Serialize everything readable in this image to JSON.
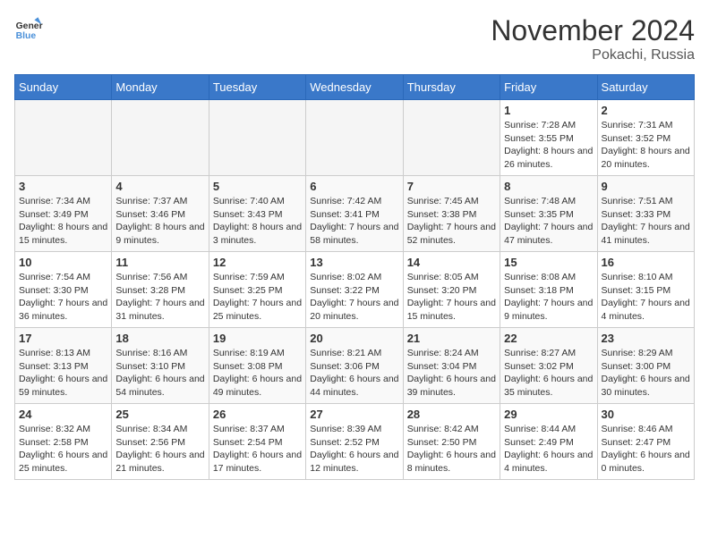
{
  "header": {
    "logo_general": "General",
    "logo_blue": "Blue",
    "month": "November 2024",
    "location": "Pokachi, Russia"
  },
  "weekdays": [
    "Sunday",
    "Monday",
    "Tuesday",
    "Wednesday",
    "Thursday",
    "Friday",
    "Saturday"
  ],
  "weeks": [
    [
      {
        "day": "",
        "info": ""
      },
      {
        "day": "",
        "info": ""
      },
      {
        "day": "",
        "info": ""
      },
      {
        "day": "",
        "info": ""
      },
      {
        "day": "",
        "info": ""
      },
      {
        "day": "1",
        "info": "Sunrise: 7:28 AM\nSunset: 3:55 PM\nDaylight: 8 hours and 26 minutes."
      },
      {
        "day": "2",
        "info": "Sunrise: 7:31 AM\nSunset: 3:52 PM\nDaylight: 8 hours and 20 minutes."
      }
    ],
    [
      {
        "day": "3",
        "info": "Sunrise: 7:34 AM\nSunset: 3:49 PM\nDaylight: 8 hours and 15 minutes."
      },
      {
        "day": "4",
        "info": "Sunrise: 7:37 AM\nSunset: 3:46 PM\nDaylight: 8 hours and 9 minutes."
      },
      {
        "day": "5",
        "info": "Sunrise: 7:40 AM\nSunset: 3:43 PM\nDaylight: 8 hours and 3 minutes."
      },
      {
        "day": "6",
        "info": "Sunrise: 7:42 AM\nSunset: 3:41 PM\nDaylight: 7 hours and 58 minutes."
      },
      {
        "day": "7",
        "info": "Sunrise: 7:45 AM\nSunset: 3:38 PM\nDaylight: 7 hours and 52 minutes."
      },
      {
        "day": "8",
        "info": "Sunrise: 7:48 AM\nSunset: 3:35 PM\nDaylight: 7 hours and 47 minutes."
      },
      {
        "day": "9",
        "info": "Sunrise: 7:51 AM\nSunset: 3:33 PM\nDaylight: 7 hours and 41 minutes."
      }
    ],
    [
      {
        "day": "10",
        "info": "Sunrise: 7:54 AM\nSunset: 3:30 PM\nDaylight: 7 hours and 36 minutes."
      },
      {
        "day": "11",
        "info": "Sunrise: 7:56 AM\nSunset: 3:28 PM\nDaylight: 7 hours and 31 minutes."
      },
      {
        "day": "12",
        "info": "Sunrise: 7:59 AM\nSunset: 3:25 PM\nDaylight: 7 hours and 25 minutes."
      },
      {
        "day": "13",
        "info": "Sunrise: 8:02 AM\nSunset: 3:22 PM\nDaylight: 7 hours and 20 minutes."
      },
      {
        "day": "14",
        "info": "Sunrise: 8:05 AM\nSunset: 3:20 PM\nDaylight: 7 hours and 15 minutes."
      },
      {
        "day": "15",
        "info": "Sunrise: 8:08 AM\nSunset: 3:18 PM\nDaylight: 7 hours and 9 minutes."
      },
      {
        "day": "16",
        "info": "Sunrise: 8:10 AM\nSunset: 3:15 PM\nDaylight: 7 hours and 4 minutes."
      }
    ],
    [
      {
        "day": "17",
        "info": "Sunrise: 8:13 AM\nSunset: 3:13 PM\nDaylight: 6 hours and 59 minutes."
      },
      {
        "day": "18",
        "info": "Sunrise: 8:16 AM\nSunset: 3:10 PM\nDaylight: 6 hours and 54 minutes."
      },
      {
        "day": "19",
        "info": "Sunrise: 8:19 AM\nSunset: 3:08 PM\nDaylight: 6 hours and 49 minutes."
      },
      {
        "day": "20",
        "info": "Sunrise: 8:21 AM\nSunset: 3:06 PM\nDaylight: 6 hours and 44 minutes."
      },
      {
        "day": "21",
        "info": "Sunrise: 8:24 AM\nSunset: 3:04 PM\nDaylight: 6 hours and 39 minutes."
      },
      {
        "day": "22",
        "info": "Sunrise: 8:27 AM\nSunset: 3:02 PM\nDaylight: 6 hours and 35 minutes."
      },
      {
        "day": "23",
        "info": "Sunrise: 8:29 AM\nSunset: 3:00 PM\nDaylight: 6 hours and 30 minutes."
      }
    ],
    [
      {
        "day": "24",
        "info": "Sunrise: 8:32 AM\nSunset: 2:58 PM\nDaylight: 6 hours and 25 minutes."
      },
      {
        "day": "25",
        "info": "Sunrise: 8:34 AM\nSunset: 2:56 PM\nDaylight: 6 hours and 21 minutes."
      },
      {
        "day": "26",
        "info": "Sunrise: 8:37 AM\nSunset: 2:54 PM\nDaylight: 6 hours and 17 minutes."
      },
      {
        "day": "27",
        "info": "Sunrise: 8:39 AM\nSunset: 2:52 PM\nDaylight: 6 hours and 12 minutes."
      },
      {
        "day": "28",
        "info": "Sunrise: 8:42 AM\nSunset: 2:50 PM\nDaylight: 6 hours and 8 minutes."
      },
      {
        "day": "29",
        "info": "Sunrise: 8:44 AM\nSunset: 2:49 PM\nDaylight: 6 hours and 4 minutes."
      },
      {
        "day": "30",
        "info": "Sunrise: 8:46 AM\nSunset: 2:47 PM\nDaylight: 6 hours and 0 minutes."
      }
    ]
  ]
}
